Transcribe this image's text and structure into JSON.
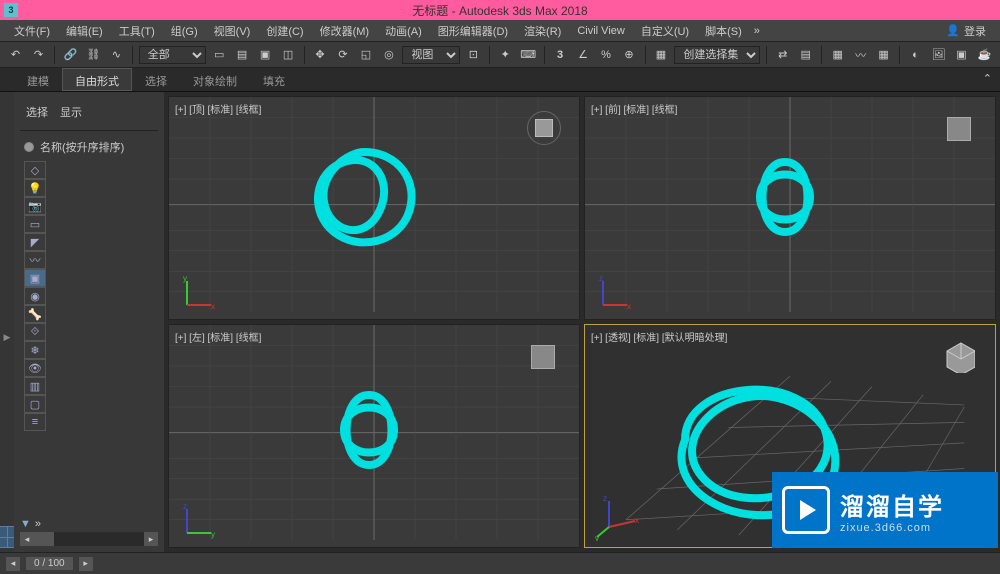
{
  "title": "无标题 - Autodesk 3ds Max 2018",
  "app_icon_text": "3",
  "menu": [
    "文件(F)",
    "编辑(E)",
    "工具(T)",
    "组(G)",
    "视图(V)",
    "创建(C)",
    "修改器(M)",
    "动画(A)",
    "图形编辑器(D)",
    "渲染(R)",
    "Civil View",
    "自定义(U)",
    "脚本(S)"
  ],
  "login": "登录",
  "toolbar_filter": "全部",
  "view_label": "视图",
  "create_set": "创建选择集",
  "ribbon": {
    "tabs": [
      "建模",
      "自由形式",
      "选择",
      "对象绘制",
      "填充"
    ],
    "active": 1
  },
  "scene": {
    "tab_select": "选择",
    "tab_display": "显示",
    "sort_label": "名称(按升序排序)"
  },
  "viewports": {
    "top": "[+] [顶] [标准] [线框]",
    "front": "[+] [前] [标准] [线框]",
    "left": "[+] [左] [标准] [线框]",
    "persp": "[+] [透视] [标准] [默认明暗处理]"
  },
  "timeline": {
    "frame": "0 / 100"
  },
  "watermark": {
    "main": "溜溜自学",
    "sub": "zixue.3d66.com"
  }
}
